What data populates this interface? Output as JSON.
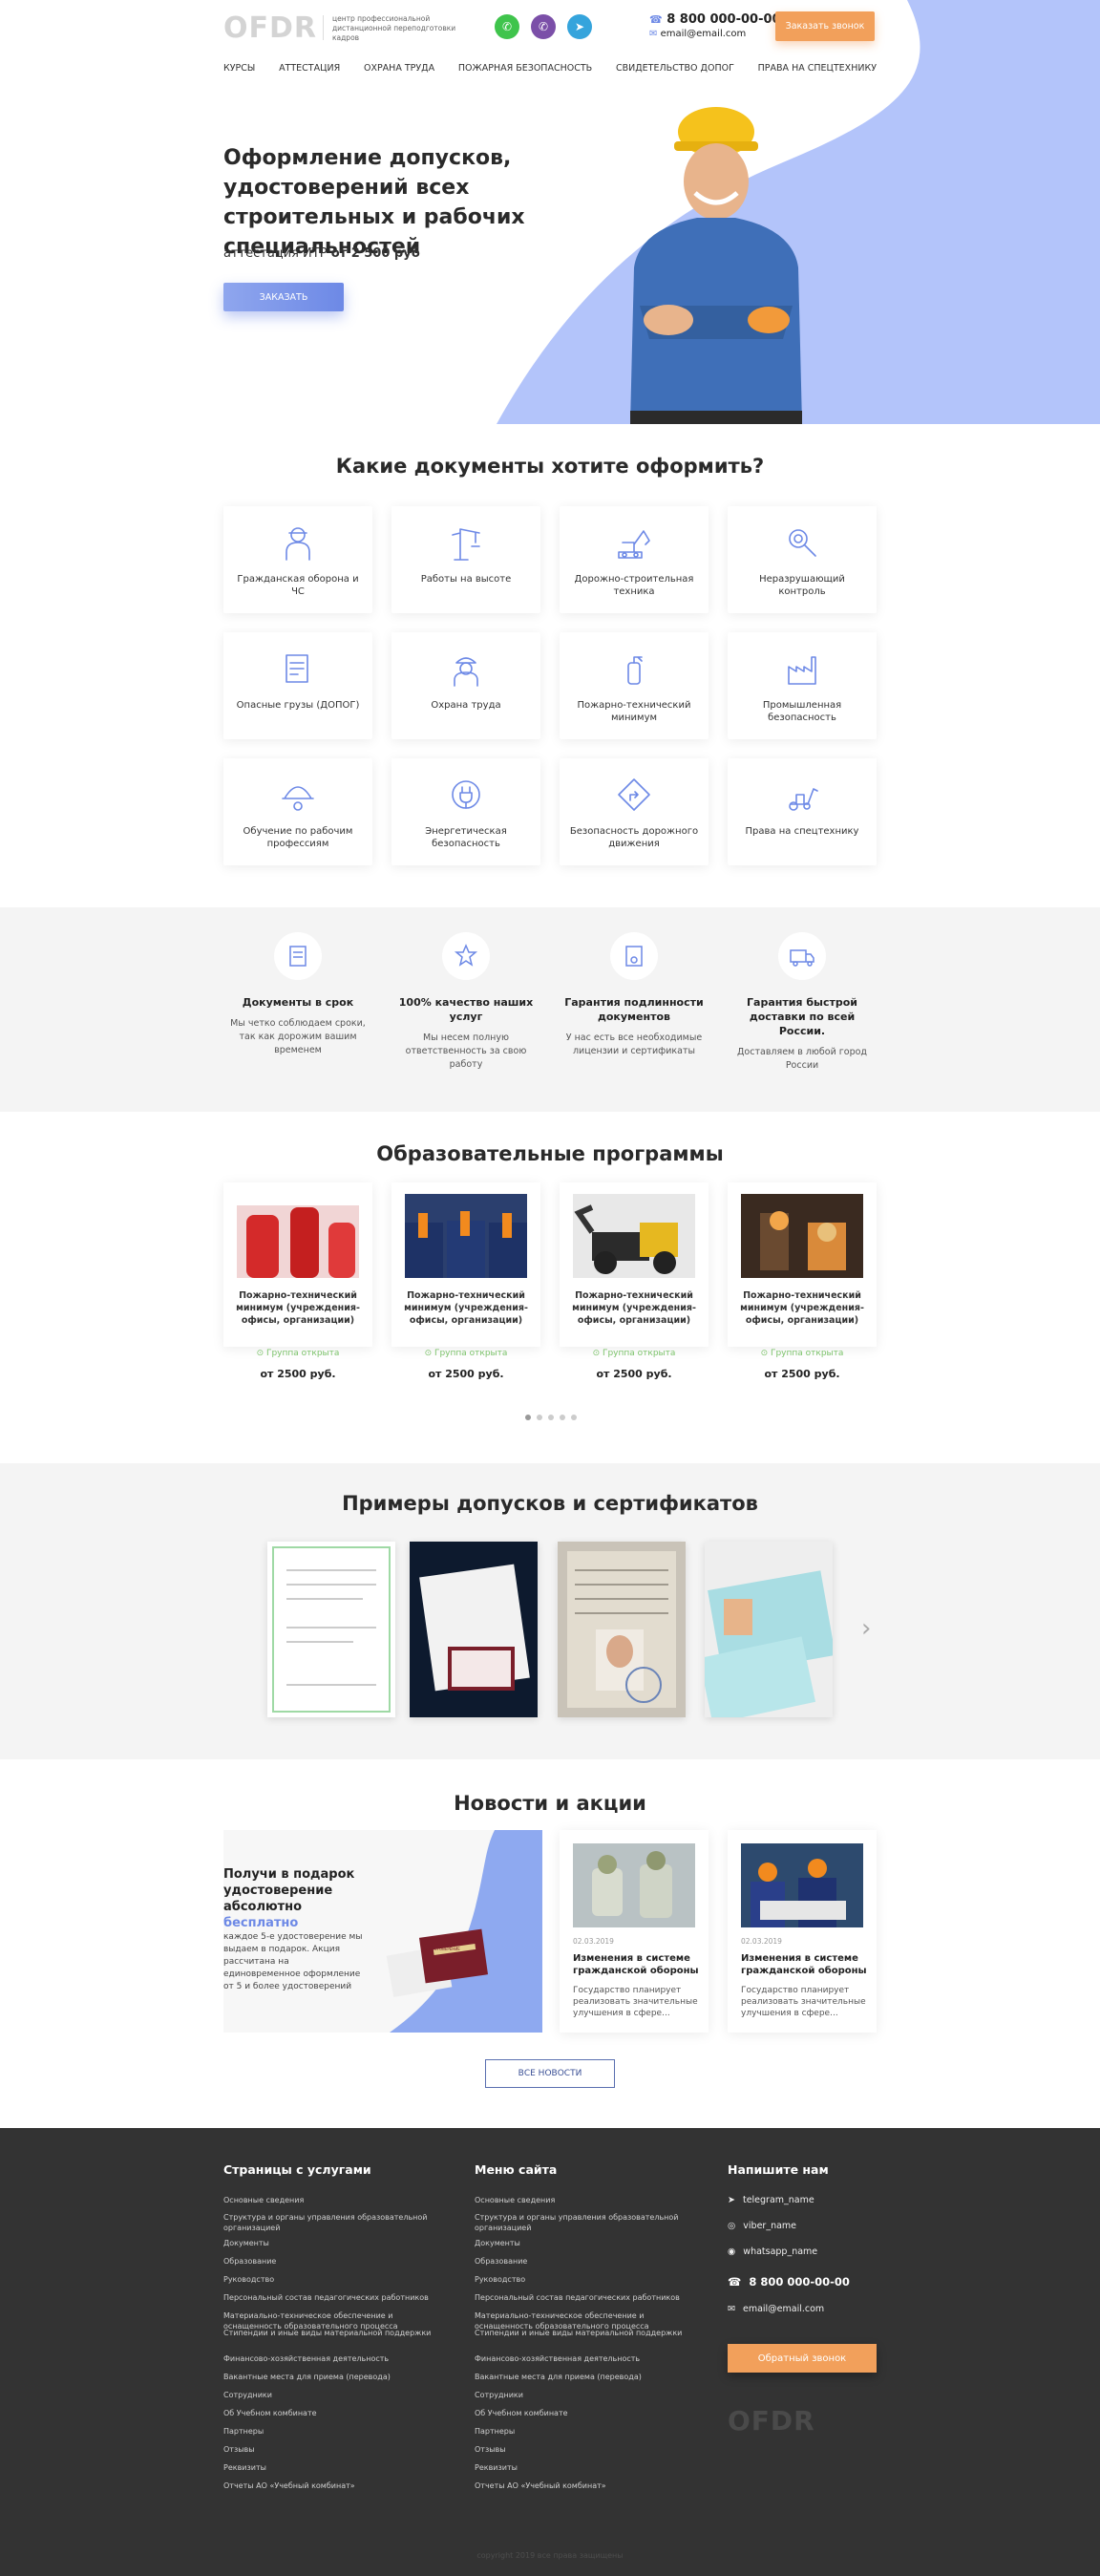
{
  "header": {
    "logo": "OFDR",
    "logo_sub": "центр профессиональной дистанционной переподготовки кадров",
    "phone": "8 800 000-00-00",
    "email": "email@email.com",
    "call_button": "Заказать звонок"
  },
  "nav": [
    "КУРСЫ",
    "АТТЕСТАЦИЯ",
    "ОХРАНА ТРУДА",
    "ПОЖАРНАЯ БЕЗОПАСНОСТЬ",
    "СВИДЕТЕЛЬСТВО ДОПОГ",
    "ПРАВА НА СПЕЦТЕХНИКУ"
  ],
  "hero": {
    "title": "Оформление допусков, удостоверений всех строительных и рабочих специальностей",
    "sub_prefix": "аттестация ИТР",
    "sub_price": "от 2 500 руб",
    "button": "ЗАКАЗАТЬ"
  },
  "docs": {
    "title": "Какие документы хотите оформить?",
    "items": [
      {
        "label": "Гражданская оборона и ЧС",
        "icon": "soldier-icon"
      },
      {
        "label": "Работы на высоте",
        "icon": "crane-icon"
      },
      {
        "label": "Дорожно-строительная техника",
        "icon": "excavator-icon"
      },
      {
        "label": "Неразрушающий контроль",
        "icon": "gear-magnifier-icon"
      },
      {
        "label": "Опасные грузы (ДОПОГ)",
        "icon": "document-icon"
      },
      {
        "label": "Охрана труда",
        "icon": "worker-icon"
      },
      {
        "label": "Пожарно-технический минимум",
        "icon": "extinguisher-icon"
      },
      {
        "label": "Промышленная безопасность",
        "icon": "factory-icon"
      },
      {
        "label": "Обучение по рабочим профессиям",
        "icon": "hardhat-icon"
      },
      {
        "label": "Энергетическая безопасность",
        "icon": "plug-icon"
      },
      {
        "label": "Безопасность дорожного движения",
        "icon": "road-sign-icon"
      },
      {
        "label": "Права на спецтехнику",
        "icon": "tractor-icon"
      }
    ]
  },
  "features": [
    {
      "title": "Документы в срок",
      "desc": "Мы четко соблюдаем сроки, так как дорожим вашим временем"
    },
    {
      "title": "100% качество наших услуг",
      "desc": "Мы несем полную ответственность за свою работу"
    },
    {
      "title": "Гарантия подлинности документов",
      "desc": "У нас есть все необходимые лицензии и сертификаты"
    },
    {
      "title": "Гарантия быстрой доставки по всей России.",
      "desc": "Доставляем в любой город России"
    }
  ],
  "programs": {
    "title": "Образовательные программы",
    "items": [
      {
        "title": "Пожарно-технический минимум (учреждения-офисы, организации)",
        "group": "Группа открыта",
        "price": "от 2500 руб."
      },
      {
        "title": "Пожарно-технический минимум (учреждения-офисы, организации)",
        "group": "Группа открыта",
        "price": "от 2500 руб."
      },
      {
        "title": "Пожарно-технический минимум (учреждения-офисы, организации)",
        "group": "Группа открыта",
        "price": "от 2500 руб."
      },
      {
        "title": "Пожарно-технический минимум (учреждения-офисы, организации)",
        "group": "Группа открыта",
        "price": "от 2500 руб."
      }
    ]
  },
  "certs": {
    "title": "Примеры допусков и сертификатов"
  },
  "news": {
    "title": "Новости и акции",
    "promo_title": "Получи в подарок удостоверение абсолютно",
    "promo_highlight": "бесплатно",
    "promo_text": "каждое 5-е удостоверение мы выдаем в подарок. Акция рассчитана на единовременное оформление от 5 и более удостоверений",
    "book_text": "УДОСТОВЕРЕНИЕ",
    "items": [
      {
        "date": "02.03.2019",
        "title": "Изменения в системе гражданской обороны",
        "desc": "Государство планирует реализовать значительные улучшения в сфере..."
      },
      {
        "date": "02.03.2019",
        "title": "Изменения в системе гражданской обороны",
        "desc": "Государство планирует реализовать значительные улучшения в сфере..."
      }
    ],
    "all_button": "ВСЕ НОВОСТИ"
  },
  "footer": {
    "col1_title": "Страницы с услугами",
    "col2_title": "Меню сайта",
    "col3_title": "Напишите нам",
    "links": [
      "Основные сведения",
      "Структура и органы управления образовательной организацией",
      "Документы",
      "Образование",
      "Руководство",
      "Персональный состав педагогических работников",
      "Материально-техническое обеспечение и оснащенность образовательного процесса",
      "Стипендии и иные виды материальной поддержки",
      "Финансово-хозяйственная деятельность",
      "Вакантные места для приема (перевода)",
      "Сотрудники",
      "Об Учебном комбинате",
      "Партнеры",
      "Отзывы",
      "Реквизиты",
      "Отчеты АО «Учебный комбинат»"
    ],
    "telegram": "telegram_name",
    "viber": "viber_name",
    "whatsapp": "whatsapp_name",
    "phone": "8 800 000-00-00",
    "email": "email@email.com",
    "call_button": "Обратный звонок",
    "logo": "OFDR",
    "copyright": "copyright 2019 все права защищены"
  },
  "colors": {
    "accent_blue": "#7b93e8",
    "accent_orange": "#f2a05b",
    "footer_bg": "#333333"
  }
}
